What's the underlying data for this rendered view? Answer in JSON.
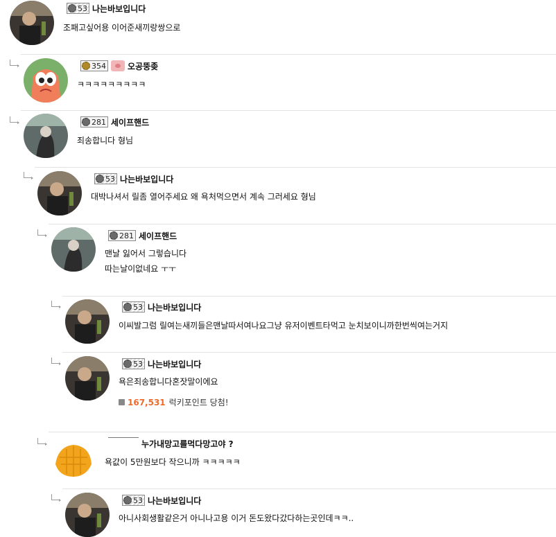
{
  "comments": [
    {
      "level": "53",
      "nick": "나는바보입니다",
      "lines": [
        "조패고싶어용 이어준새끼랑쌍으로"
      ]
    },
    {
      "level": "354",
      "nick": "오공뚱좆",
      "lines": [
        "ㅋㅋㅋㅋㅋㅋㅋㅋㅋ"
      ]
    },
    {
      "level": "281",
      "nick": "세이프핸드",
      "lines": [
        "죄송합니다 형님"
      ]
    },
    {
      "level": "53",
      "nick": "나는바보입니다",
      "lines": [
        "대박나셔서 릴좀 열어주세요 왜 욕처먹으면서 계속 그러세요 형님"
      ]
    },
    {
      "level": "281",
      "nick": "세이프핸드",
      "lines": [
        "맨날 잃어서 그렇습니다",
        "따는날이없네요 ㅜㅜ"
      ]
    },
    {
      "level": "53",
      "nick": "나는바보입니다",
      "lines": [
        "이씨발그럼 릴여는새끼들은맨날따서여나요그냥 유저이벤트타먹고 눈치보이니까한번씩여는거지"
      ]
    },
    {
      "level": "53",
      "nick": "나는바보입니다",
      "lines": [
        "욕은죄송합니다혼잣말이에요"
      ],
      "points": "167,531",
      "points_label": "럭키포인트 당첨!"
    },
    {
      "level": "",
      "nick": "누가내망고를먹다망고야 ?",
      "lines": [
        "욕값이 5만원보다 작으니까 ㅋㅋㅋㅋㅋ"
      ]
    },
    {
      "level": "53",
      "nick": "나는바보입니다",
      "lines": [
        "아니사회생활같은거 아니나고용 이거 돈도왔다갔다하는곳인데ㅋㅋ.."
      ]
    }
  ]
}
